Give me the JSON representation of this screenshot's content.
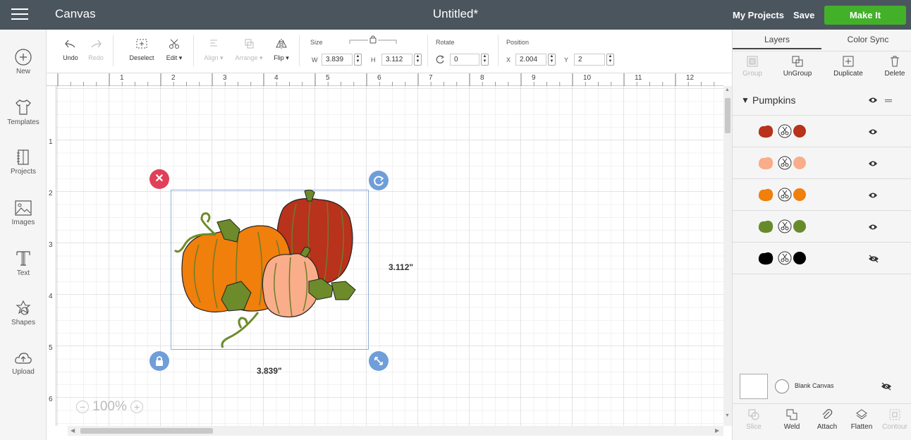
{
  "header": {
    "app_title": "Canvas",
    "doc_title": "Untitled*",
    "my_projects": "My Projects",
    "save": "Save",
    "make_it": "Make It"
  },
  "sidebar": {
    "items": [
      {
        "label": "New",
        "icon": "plus-circle-icon"
      },
      {
        "label": "Templates",
        "icon": "shirt-icon"
      },
      {
        "label": "Projects",
        "icon": "projects-icon"
      },
      {
        "label": "Images",
        "icon": "image-icon"
      },
      {
        "label": "Text",
        "icon": "text-icon"
      },
      {
        "label": "Shapes",
        "icon": "shapes-icon"
      },
      {
        "label": "Upload",
        "icon": "cloud-upload-icon"
      }
    ]
  },
  "toolbar": {
    "undo": "Undo",
    "redo": "Redo",
    "deselect": "Deselect",
    "edit": "Edit",
    "align": "Align",
    "arrange": "Arrange",
    "flip": "Flip",
    "size_label": "Size",
    "w_label": "W",
    "w_value": "3.839",
    "h_label": "H",
    "h_value": "3.112",
    "rotate_label": "Rotate",
    "rotate_value": "0",
    "position_label": "Position",
    "x_label": "X",
    "x_value": "2.004",
    "y_label": "Y",
    "y_value": "2"
  },
  "canvas": {
    "ruler_top": [
      "1",
      "2",
      "3",
      "4",
      "5",
      "6",
      "7",
      "8",
      "9",
      "10",
      "11",
      "12"
    ],
    "ruler_left": [
      "1",
      "2",
      "3",
      "4",
      "5",
      "6"
    ],
    "width_dim": "3.839\"",
    "height_dim": "3.112\"",
    "zoom": "100%"
  },
  "right_panel": {
    "tabs": [
      "Layers",
      "Color Sync"
    ],
    "actions": [
      "Group",
      "UnGroup",
      "Duplicate",
      "Delete"
    ],
    "group_name": "Pumpkins",
    "layers": [
      {
        "color": "#b8321c",
        "visible": true
      },
      {
        "color": "#f9ad8a",
        "visible": true
      },
      {
        "color": "#f07f0c",
        "visible": true
      },
      {
        "color": "#678b2a",
        "visible": true
      },
      {
        "color": "#000000",
        "visible": false
      }
    ],
    "blank_canvas": "Blank Canvas",
    "bottom_actions": [
      "Slice",
      "Weld",
      "Attach",
      "Flatten",
      "Contour"
    ]
  }
}
